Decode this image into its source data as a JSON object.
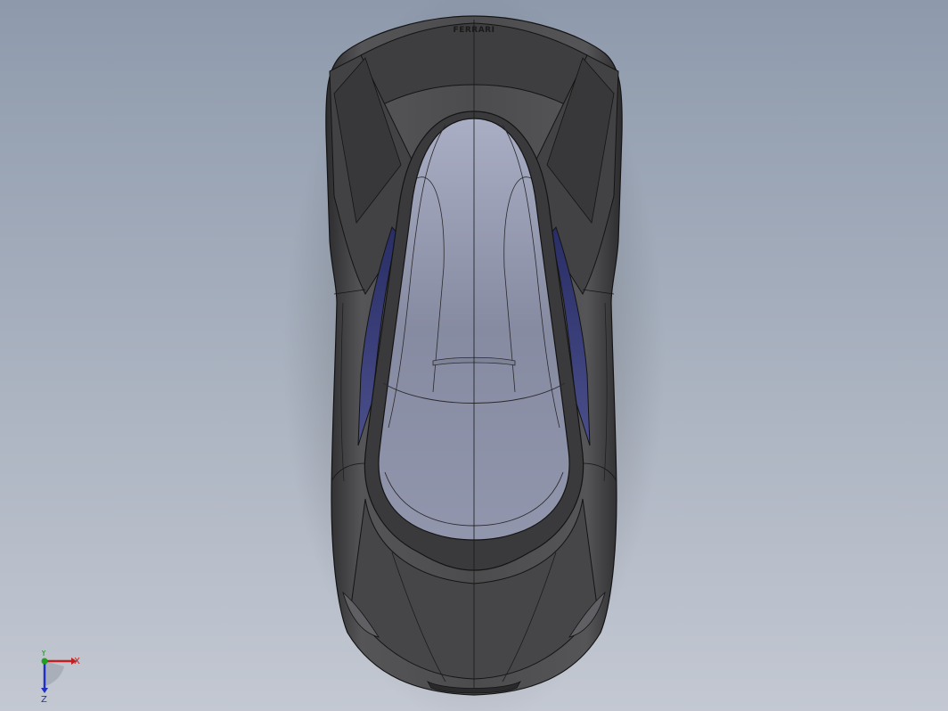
{
  "view": {
    "background_top": "#8e9aac",
    "background_bottom": "#c3c8d2"
  },
  "model": {
    "badge_text": "FERRARI",
    "body_color": "#4a4a4c",
    "canopy_color": "#8a8fa6",
    "side_glass_color": "#3a3e78",
    "edge_color": "#141414"
  },
  "triad": {
    "x_label": "X",
    "y_label": "Y",
    "z_label": "Z",
    "x_color": "#c02020",
    "y_color": "#20a020",
    "z_color": "#2030c0"
  }
}
